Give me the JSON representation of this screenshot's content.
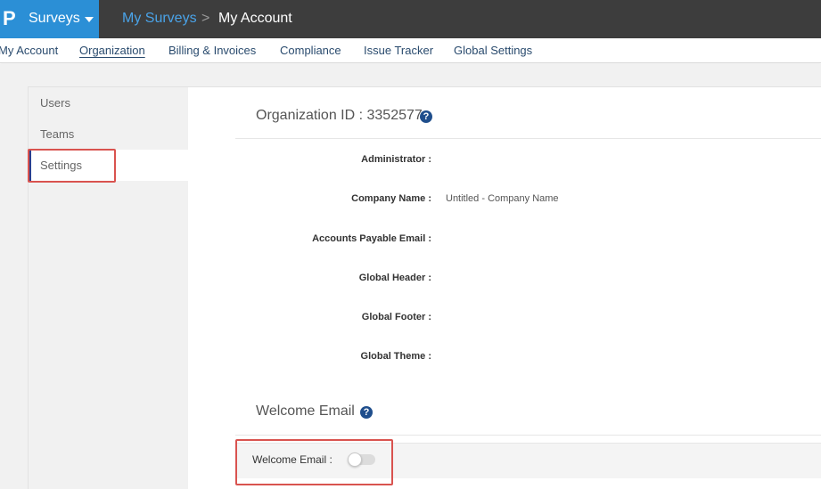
{
  "topbar": {
    "logo_glyph": "P",
    "app_label": "Surveys",
    "breadcrumb_link": "My Surveys",
    "breadcrumb_separator": ">",
    "breadcrumb_current": "My Account",
    "colors": {
      "bar": "#3d3d3d",
      "brand": "#2b8fd6",
      "link": "#4aa3e8"
    }
  },
  "subnav": {
    "items": [
      {
        "label": "My Account"
      },
      {
        "label": "Organization",
        "active": true
      },
      {
        "label": "Billing & Invoices"
      },
      {
        "label": "Compliance"
      },
      {
        "label": "Issue Tracker"
      },
      {
        "label": "Global Settings"
      }
    ]
  },
  "sidebar": {
    "items": [
      {
        "label": "Users"
      },
      {
        "label": "Teams"
      },
      {
        "label": "Settings",
        "active": true
      }
    ]
  },
  "organization": {
    "title": "Organization ID : 3352577",
    "help_icon": "?",
    "fields": [
      {
        "label": "Administrator :",
        "value": ""
      },
      {
        "label": "Company Name :",
        "value": "Untitled - Company Name"
      },
      {
        "label": "Accounts Payable Email :",
        "value": ""
      },
      {
        "label": "Global Header :",
        "value": ""
      },
      {
        "label": "Global Footer :",
        "value": ""
      },
      {
        "label": "Global Theme :",
        "value": ""
      }
    ]
  },
  "welcome": {
    "title": "Welcome Email",
    "help_icon": "?",
    "label": "Welcome Email :",
    "enabled": false
  },
  "highlight_color": "#d9534f"
}
